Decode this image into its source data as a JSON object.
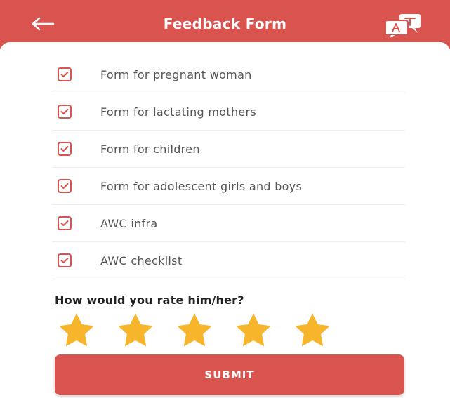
{
  "theme": {
    "accent": "#d9534f",
    "star_color": "#f7b52c"
  },
  "header": {
    "title": "Feedback Form",
    "back_icon": "arrow-left-icon",
    "language_icon": "translate-icon"
  },
  "form_items": [
    {
      "label": "Form for pregnant woman",
      "checked": true
    },
    {
      "label": "Form for lactating mothers",
      "checked": true
    },
    {
      "label": "Form for children",
      "checked": true
    },
    {
      "label": "Form for adolescent girls and boys",
      "checked": true
    },
    {
      "label": "AWC infra",
      "checked": true
    },
    {
      "label": "AWC checklist",
      "checked": true
    }
  ],
  "rating": {
    "question": "How would you rate him/her?",
    "value": 5,
    "max": 5
  },
  "submit_label": "SUBMIT"
}
